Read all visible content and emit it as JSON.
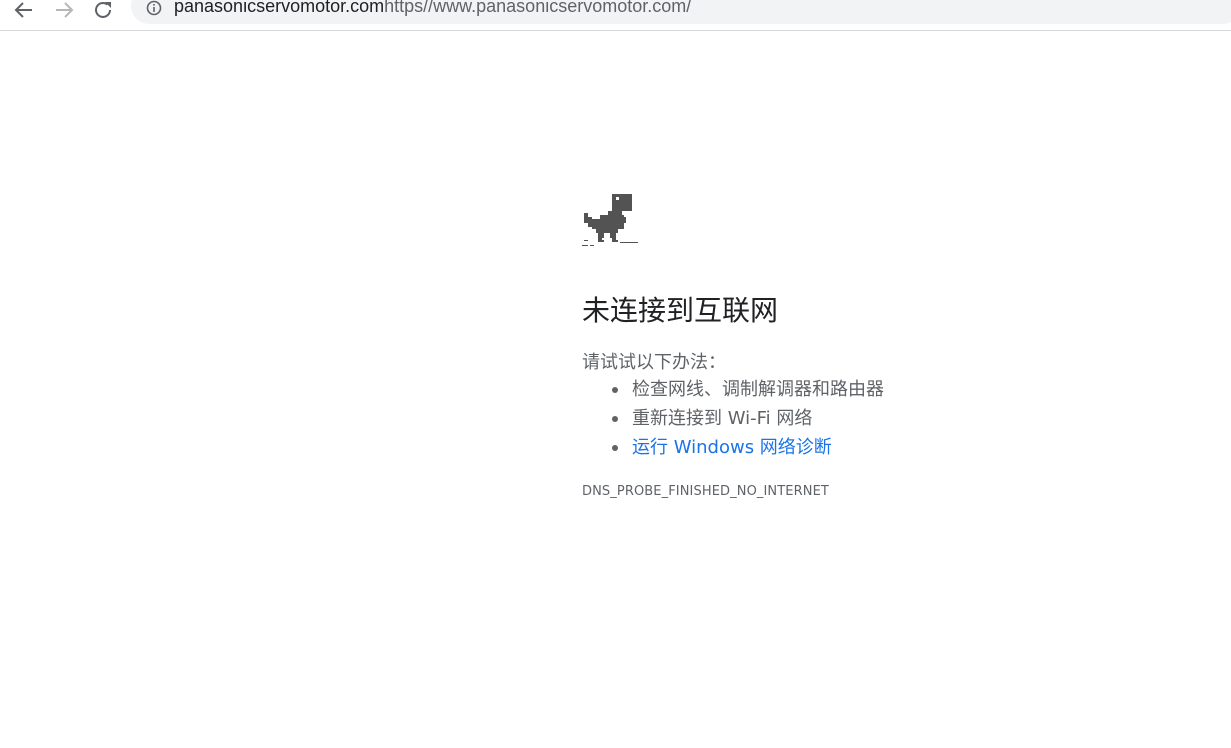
{
  "toolbar": {
    "back_icon": "arrow-left-icon",
    "forward_icon": "arrow-right-icon",
    "reload_icon": "reload-icon",
    "info_icon": "info-icon",
    "url_domain": "panasonicservomotor.com",
    "url_rest": "https//www.panasonicservomotor.com/"
  },
  "error": {
    "illustration": "dinosaur-icon",
    "title": "未连接到互联网",
    "subtitle": "请试试以下办法：",
    "suggestions": [
      "检查网线、调制解调器和路由器",
      "重新连接到 Wi-Fi 网络",
      "运行 Windows 网络诊断"
    ],
    "code": "DNS_PROBE_FINISHED_NO_INTERNET"
  },
  "colors": {
    "text": "#202124",
    "secondary": "#5f6368",
    "link": "#1a73e8",
    "omnibox": "#f1f3f4"
  }
}
